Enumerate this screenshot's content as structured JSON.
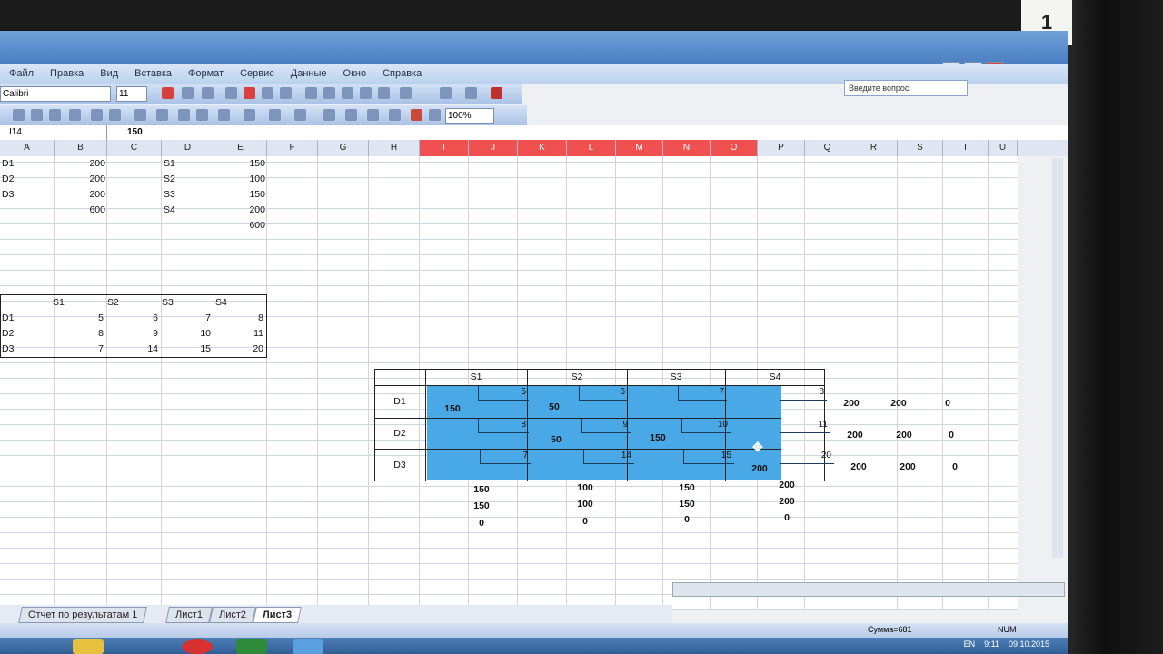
{
  "sticker": "1",
  "window": {
    "menus": [
      "Файл",
      "Правка",
      "Вид",
      "Вставка",
      "Формат",
      "Сервис",
      "Данные",
      "Окно",
      "Справка"
    ],
    "question_placeholder": "Введите вопрос",
    "min": "–",
    "max": "□",
    "close": "✕"
  },
  "toolbar": {
    "font": "Calibri",
    "size": "11",
    "zoom": "100%"
  },
  "formula": {
    "namebox": "I14",
    "fx": "fx",
    "value": "150"
  },
  "columns": [
    "A",
    "B",
    "C",
    "D",
    "E",
    "F",
    "G",
    "H",
    "I",
    "J",
    "K",
    "L",
    "M",
    "N",
    "O",
    "P",
    "Q",
    "R",
    "S",
    "T",
    "U"
  ],
  "supply": {
    "labels": [
      "D1",
      "D2",
      "D3"
    ],
    "values": [
      "200",
      "200",
      "200",
      "600"
    ],
    "demand_labels": [
      "S1",
      "S2",
      "S3",
      "S4"
    ],
    "demand_values": [
      "150",
      "100",
      "150",
      "200",
      "600"
    ]
  },
  "costs": {
    "headers": [
      "S1",
      "S2",
      "S3",
      "S4"
    ],
    "rows": [
      {
        "label": "D1",
        "values": [
          "5",
          "6",
          "7",
          "8"
        ]
      },
      {
        "label": "D2",
        "values": [
          "8",
          "9",
          "10",
          "11"
        ]
      },
      {
        "label": "D3",
        "values": [
          "7",
          "14",
          "15",
          "20"
        ]
      }
    ]
  },
  "transport": {
    "headers": [
      "S1",
      "S2",
      "S3",
      "S4"
    ],
    "row_labels": [
      "D1",
      "D2",
      "D3"
    ],
    "costs": [
      [
        "5",
        "6",
        "7",
        "8"
      ],
      [
        "8",
        "9",
        "10",
        "11"
      ],
      [
        "7",
        "14",
        "15",
        "20"
      ]
    ],
    "alloc": [
      [
        "150",
        "50",
        "",
        ""
      ],
      [
        "",
        "50",
        "150",
        ""
      ],
      [
        "",
        "",
        "",
        "200"
      ]
    ],
    "right": [
      [
        "200",
        "200",
        "0"
      ],
      [
        "200",
        "200",
        "0"
      ],
      [
        "200",
        "200",
        "0"
      ]
    ],
    "bottom": [
      [
        "150",
        "100",
        "150",
        "200"
      ],
      [
        "150",
        "100",
        "150",
        "200"
      ],
      [
        "0",
        "0",
        "0",
        "0"
      ]
    ]
  },
  "sheets": [
    "Отчет по результатам 1",
    "Лист1",
    "Лист2",
    "Лист3"
  ],
  "status": {
    "sum": "Сумма=681",
    "num": "NUM"
  },
  "tray": {
    "lang": "EN",
    "time": "9:11",
    "date": "09.10.2015"
  }
}
